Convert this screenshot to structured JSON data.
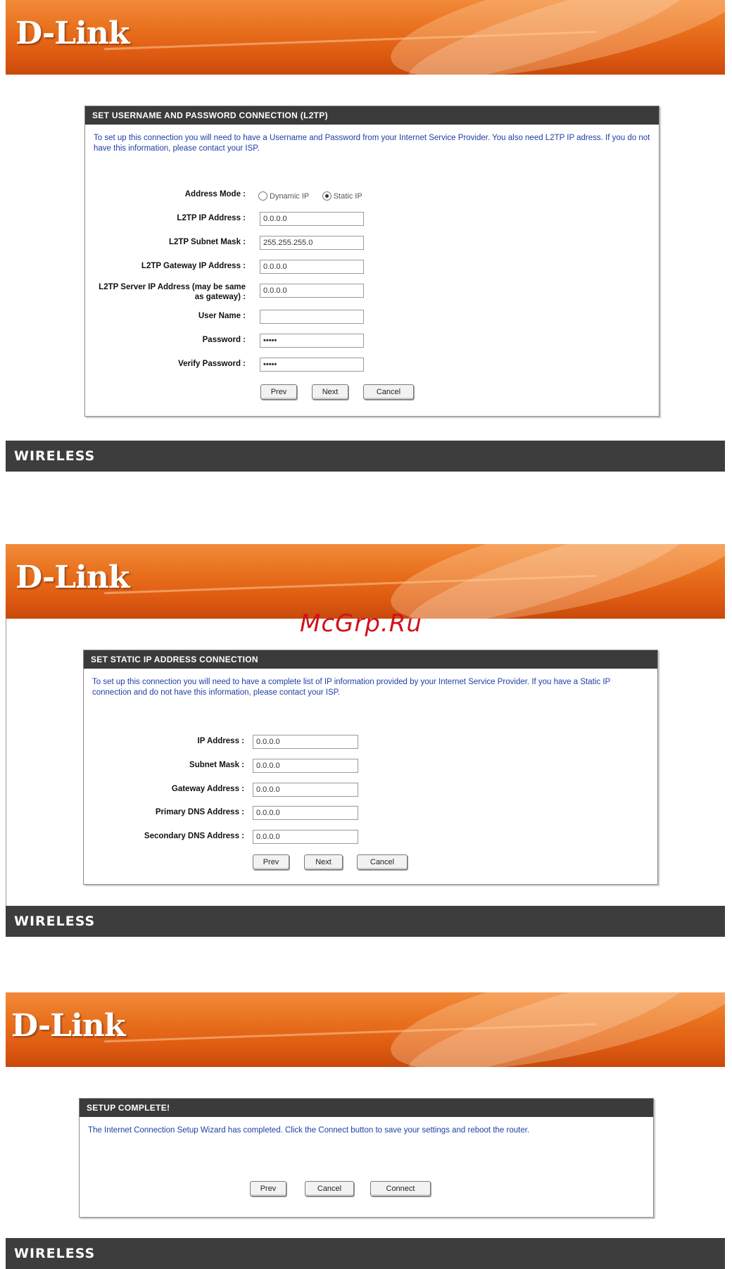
{
  "brand": "D-Link",
  "footer_label": "WIRELESS",
  "watermark": "McGrp.Ru",
  "screens": {
    "l2tp": {
      "header": "SET USERNAME AND PASSWORD CONNECTION (L2TP)",
      "description": "To set up this connection you will need to have a Username and Password from your Internet Service Provider. You also need L2TP IP adress. If you do not have this information, please contact your ISP.",
      "address_mode_label": "Address Mode :",
      "address_mode_options": [
        "Dynamic IP",
        "Static IP"
      ],
      "fields": [
        {
          "label": "L2TP IP Address :",
          "value": "0.0.0.0"
        },
        {
          "label": "L2TP Subnet Mask :",
          "value": "255.255.255.0"
        },
        {
          "label": "L2TP Gateway IP Address :",
          "value": "0.0.0.0"
        },
        {
          "label": "L2TP Server IP Address (may be same as gateway) :",
          "value": "0.0.0.0"
        },
        {
          "label": "User Name :",
          "value": ""
        },
        {
          "label": "Password :",
          "value": "•••••"
        },
        {
          "label": "Verify Password :",
          "value": "•••••"
        }
      ],
      "buttons": {
        "prev": "Prev",
        "next": "Next",
        "cancel": "Cancel"
      }
    },
    "static": {
      "header": "SET STATIC IP ADDRESS CONNECTION",
      "description": "To set up this connection you will need to have a complete list of IP information provided by your Internet Service Provider. If you have a Static IP connection and do not have this information, please contact your ISP.",
      "fields": [
        {
          "label": "IP Address :",
          "value": "0.0.0.0"
        },
        {
          "label": "Subnet Mask :",
          "value": "0.0.0.0"
        },
        {
          "label": "Gateway Address :",
          "value": "0.0.0.0"
        },
        {
          "label": "Primary DNS Address :",
          "value": "0.0.0.0"
        },
        {
          "label": "Secondary DNS Address :",
          "value": "0.0.0.0"
        }
      ],
      "buttons": {
        "prev": "Prev",
        "next": "Next",
        "cancel": "Cancel"
      }
    },
    "complete": {
      "header": "SETUP COMPLETE!",
      "description": "The Internet Connection Setup Wizard has completed. Click the Connect button to save your settings and reboot the router.",
      "buttons": {
        "prev": "Prev",
        "cancel": "Cancel",
        "connect": "Connect"
      }
    }
  }
}
